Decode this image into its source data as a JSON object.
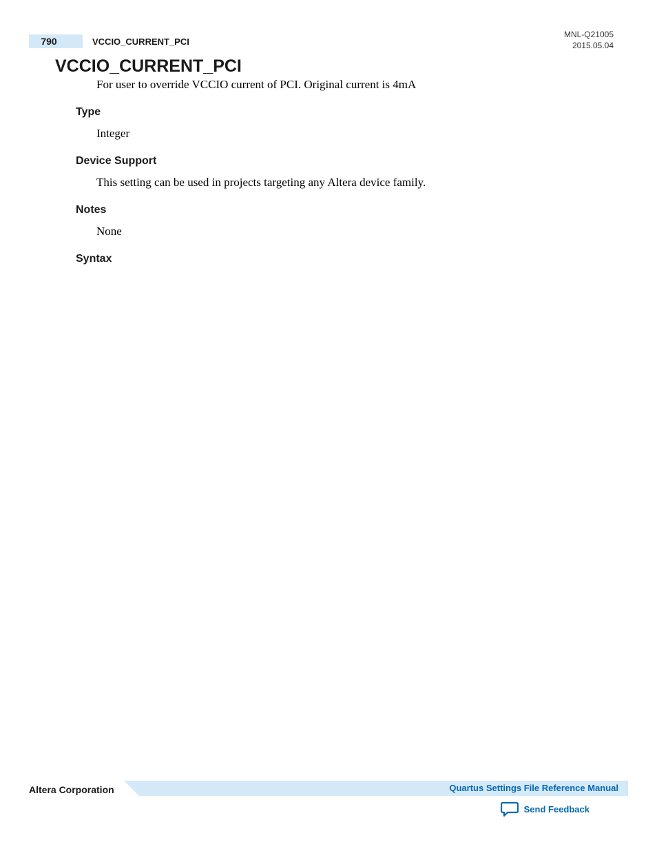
{
  "header": {
    "page_number": "790",
    "title": "VCCIO_CURRENT_PCI",
    "doc_id": "MNL-Q21005",
    "doc_date": "2015.05.04"
  },
  "content": {
    "heading": "VCCIO_CURRENT_PCI",
    "intro": "For user to override VCCIO current of PCI. Original current is 4mA",
    "sections": {
      "type": {
        "heading": "Type",
        "body": "Integer"
      },
      "device_support": {
        "heading": "Device Support",
        "body": "This setting can be used in projects targeting any Altera device family."
      },
      "notes": {
        "heading": "Notes",
        "body": "None"
      },
      "syntax": {
        "heading": "Syntax",
        "body": ""
      }
    }
  },
  "footer": {
    "company": "Altera Corporation",
    "manual_link": "Quartus Settings File Reference Manual",
    "feedback_label": "Send Feedback"
  }
}
